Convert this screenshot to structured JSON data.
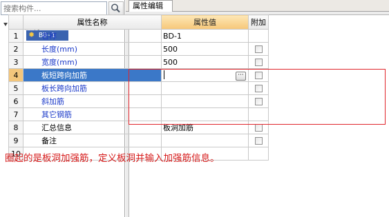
{
  "search": {
    "placeholder": "搜索构件..."
  },
  "tree": {
    "root_label": "板洞",
    "child_label": "BD-1"
  },
  "tabs": [
    {
      "label": "属性编辑"
    }
  ],
  "grid": {
    "headers": {
      "name": "属性名称",
      "value": "属性值",
      "extra": "附加"
    },
    "rows": [
      {
        "num": "1",
        "name": "名称",
        "value": "BD-1",
        "attr": true,
        "checkbox": false,
        "selected": false
      },
      {
        "num": "2",
        "name": "长度(mm)",
        "value": "500",
        "attr": true,
        "checkbox": true,
        "selected": false
      },
      {
        "num": "3",
        "name": "宽度(mm)",
        "value": "500",
        "attr": true,
        "checkbox": true,
        "selected": false
      },
      {
        "num": "4",
        "name": "板短跨向加筋",
        "value": "",
        "attr": true,
        "checkbox": true,
        "selected": true
      },
      {
        "num": "5",
        "name": "板长跨向加筋",
        "value": "",
        "attr": true,
        "checkbox": true,
        "selected": false
      },
      {
        "num": "6",
        "name": "斜加筋",
        "value": "",
        "attr": true,
        "checkbox": true,
        "selected": false
      },
      {
        "num": "7",
        "name": "其它钢筋",
        "value": "",
        "attr": true,
        "checkbox": false,
        "selected": false
      },
      {
        "num": "8",
        "name": "汇总信息",
        "value": "板洞加筋",
        "attr": false,
        "checkbox": true,
        "selected": false
      },
      {
        "num": "9",
        "name": "备注",
        "value": "",
        "attr": false,
        "checkbox": true,
        "selected": false
      },
      {
        "num": "10",
        "name": "",
        "value": "",
        "attr": false,
        "checkbox": false,
        "selected": false
      }
    ]
  },
  "annotation": {
    "caption": "圈起的是板洞加强筋，定义板洞并输入加强筋信息。",
    "color": "#d61a1a"
  },
  "colors": {
    "selection": "#3b78c8",
    "header_accent": "#f6c779",
    "highlight": "#e0242b"
  }
}
